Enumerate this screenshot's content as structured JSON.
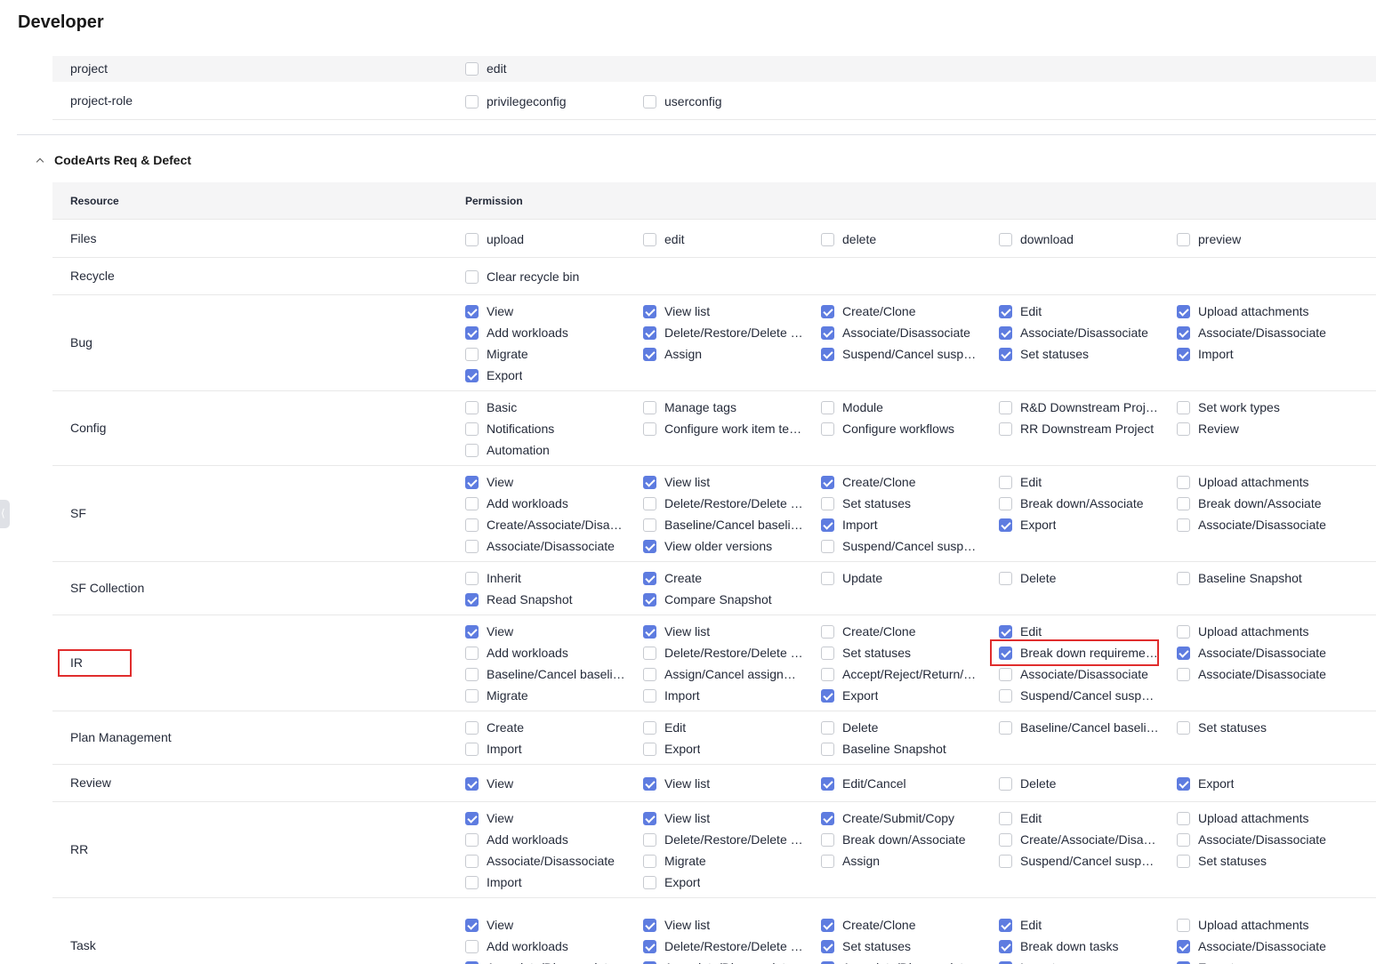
{
  "page": {
    "title": "Developer"
  },
  "upper_rows": [
    {
      "resource": "project",
      "permissions": [
        {
          "label": "edit",
          "checked": false
        }
      ]
    },
    {
      "resource": "project-role",
      "permissions": [
        {
          "label": "privilegeconfig",
          "checked": false
        },
        {
          "label": "userconfig",
          "checked": false
        }
      ]
    }
  ],
  "section": {
    "title": "CodeArts Req & Defect",
    "headers": {
      "resource": "Resource",
      "permission": "Permission"
    },
    "rows": [
      {
        "resource": "Files",
        "permissions": [
          {
            "label": "upload",
            "checked": false
          },
          {
            "label": "edit",
            "checked": false
          },
          {
            "label": "delete",
            "checked": false
          },
          {
            "label": "download",
            "checked": false
          },
          {
            "label": "preview",
            "checked": false
          }
        ]
      },
      {
        "resource": "Recycle",
        "permissions": [
          {
            "label": "Clear recycle bin",
            "checked": false
          }
        ]
      },
      {
        "resource": "Bug",
        "permissions": [
          {
            "label": "View",
            "checked": true
          },
          {
            "label": "View list",
            "checked": true
          },
          {
            "label": "Create/Clone",
            "checked": true
          },
          {
            "label": "Edit",
            "checked": true
          },
          {
            "label": "Upload attachments",
            "checked": true
          },
          {
            "label": "Add workloads",
            "checked": true
          },
          {
            "label": "Delete/Restore/Delete permanently",
            "checked": true
          },
          {
            "label": "Associate/Disassociate",
            "checked": true
          },
          {
            "label": "Associate/Disassociate",
            "checked": true
          },
          {
            "label": "Associate/Disassociate",
            "checked": true
          },
          {
            "label": "Migrate",
            "checked": false
          },
          {
            "label": "Assign",
            "checked": true
          },
          {
            "label": "Suspend/Cancel suspension",
            "checked": true
          },
          {
            "label": "Set statuses",
            "checked": true
          },
          {
            "label": "Import",
            "checked": true
          },
          {
            "label": "Export",
            "checked": true
          }
        ]
      },
      {
        "resource": "Config",
        "permissions": [
          {
            "label": "Basic",
            "checked": false
          },
          {
            "label": "Manage tags",
            "checked": false
          },
          {
            "label": "Module",
            "checked": false
          },
          {
            "label": "R&D Downstream Project",
            "checked": false
          },
          {
            "label": "Set work types",
            "checked": false
          },
          {
            "label": "Notifications",
            "checked": false
          },
          {
            "label": "Configure work item templates",
            "checked": false
          },
          {
            "label": "Configure workflows",
            "checked": false
          },
          {
            "label": "RR Downstream Project",
            "checked": false
          },
          {
            "label": "Review",
            "checked": false
          },
          {
            "label": "Automation",
            "checked": false
          }
        ]
      },
      {
        "resource": "SF",
        "permissions": [
          {
            "label": "View",
            "checked": true
          },
          {
            "label": "View list",
            "checked": true
          },
          {
            "label": "Create/Clone",
            "checked": true
          },
          {
            "label": "Edit",
            "checked": false
          },
          {
            "label": "Upload attachments",
            "checked": false
          },
          {
            "label": "Add workloads",
            "checked": false
          },
          {
            "label": "Delete/Restore/Delete permanently",
            "checked": false
          },
          {
            "label": "Set statuses",
            "checked": false
          },
          {
            "label": "Break down/Associate",
            "checked": false
          },
          {
            "label": "Break down/Associate",
            "checked": false
          },
          {
            "label": "Create/Associate/Disassociate",
            "checked": false
          },
          {
            "label": "Baseline/Cancel baseline",
            "checked": false
          },
          {
            "label": "Import",
            "checked": true
          },
          {
            "label": "Export",
            "checked": true
          },
          {
            "label": "Associate/Disassociate",
            "checked": false
          },
          {
            "label": "Associate/Disassociate",
            "checked": false
          },
          {
            "label": "View older versions",
            "checked": true
          },
          {
            "label": "Suspend/Cancel suspension",
            "checked": false
          }
        ]
      },
      {
        "resource": "SF Collection",
        "permissions": [
          {
            "label": "Inherit",
            "checked": false
          },
          {
            "label": "Create",
            "checked": true
          },
          {
            "label": "Update",
            "checked": false
          },
          {
            "label": "Delete",
            "checked": false
          },
          {
            "label": "Baseline Snapshot",
            "checked": false
          },
          {
            "label": "Read Snapshot",
            "checked": true
          },
          {
            "label": "Compare Snapshot",
            "checked": true
          }
        ]
      },
      {
        "resource": "IR",
        "permissions": [
          {
            "label": "View",
            "checked": true
          },
          {
            "label": "View list",
            "checked": true
          },
          {
            "label": "Create/Clone",
            "checked": false
          },
          {
            "label": "Edit",
            "checked": true
          },
          {
            "label": "Upload attachments",
            "checked": false
          },
          {
            "label": "Add workloads",
            "checked": false
          },
          {
            "label": "Delete/Restore/Delete permanently",
            "checked": false
          },
          {
            "label": "Set statuses",
            "checked": false
          },
          {
            "label": "Break down requirements",
            "checked": true
          },
          {
            "label": "Associate/Disassociate",
            "checked": true
          },
          {
            "label": "Baseline/Cancel baseline",
            "checked": false
          },
          {
            "label": "Assign/Cancel assignment",
            "checked": false
          },
          {
            "label": "Accept/Reject/Return/Close",
            "checked": false
          },
          {
            "label": "Associate/Disassociate",
            "checked": false
          },
          {
            "label": "Associate/Disassociate",
            "checked": false
          },
          {
            "label": "Migrate",
            "checked": false
          },
          {
            "label": "Import",
            "checked": false
          },
          {
            "label": "Export",
            "checked": true
          },
          {
            "label": "Suspend/Cancel suspension",
            "checked": false
          }
        ]
      },
      {
        "resource": "Plan Management",
        "permissions": [
          {
            "label": "Create",
            "checked": false
          },
          {
            "label": "Edit",
            "checked": false
          },
          {
            "label": "Delete",
            "checked": false
          },
          {
            "label": "Baseline/Cancel baseline",
            "checked": false
          },
          {
            "label": "Set statuses",
            "checked": false
          },
          {
            "label": "Import",
            "checked": false
          },
          {
            "label": "Export",
            "checked": false
          },
          {
            "label": "Baseline Snapshot",
            "checked": false
          }
        ]
      },
      {
        "resource": "Review",
        "permissions": [
          {
            "label": "View",
            "checked": true
          },
          {
            "label": "View list",
            "checked": true
          },
          {
            "label": "Edit/Cancel",
            "checked": true
          },
          {
            "label": "Delete",
            "checked": false
          },
          {
            "label": "Export",
            "checked": true
          }
        ]
      },
      {
        "resource": "RR",
        "permissions": [
          {
            "label": "View",
            "checked": true
          },
          {
            "label": "View list",
            "checked": true
          },
          {
            "label": "Create/Submit/Copy",
            "checked": true
          },
          {
            "label": "Edit",
            "checked": false
          },
          {
            "label": "Upload attachments",
            "checked": false
          },
          {
            "label": "Add workloads",
            "checked": false
          },
          {
            "label": "Delete/Restore/Delete permanently",
            "checked": false
          },
          {
            "label": "Break down/Associate",
            "checked": false
          },
          {
            "label": "Create/Associate/Disassociate",
            "checked": false
          },
          {
            "label": "Associate/Disassociate",
            "checked": false
          },
          {
            "label": "Associate/Disassociate",
            "checked": false
          },
          {
            "label": "Migrate",
            "checked": false
          },
          {
            "label": "Assign",
            "checked": false
          },
          {
            "label": "Suspend/Cancel suspension",
            "checked": false
          },
          {
            "label": "Set statuses",
            "checked": false
          },
          {
            "label": "Import",
            "checked": false
          },
          {
            "label": "Export",
            "checked": false
          }
        ]
      },
      {
        "resource": "Task",
        "permissions": [
          {
            "label": "View",
            "checked": true
          },
          {
            "label": "View list",
            "checked": true
          },
          {
            "label": "Create/Clone",
            "checked": true
          },
          {
            "label": "Edit",
            "checked": true
          },
          {
            "label": "Upload attachments",
            "checked": false
          },
          {
            "label": "Add workloads",
            "checked": false
          },
          {
            "label": "Delete/Restore/Delete permanently",
            "checked": true
          },
          {
            "label": "Set statuses",
            "checked": true
          },
          {
            "label": "Break down tasks",
            "checked": true
          },
          {
            "label": "Associate/Disassociate",
            "checked": true
          },
          {
            "label": "Associate/Disassociate",
            "checked": true
          },
          {
            "label": "Associate/Disassociate",
            "checked": true
          },
          {
            "label": "Associate/Disassociate",
            "checked": true
          },
          {
            "label": "Import",
            "checked": true
          },
          {
            "label": "Export",
            "checked": true
          }
        ]
      }
    ]
  }
}
